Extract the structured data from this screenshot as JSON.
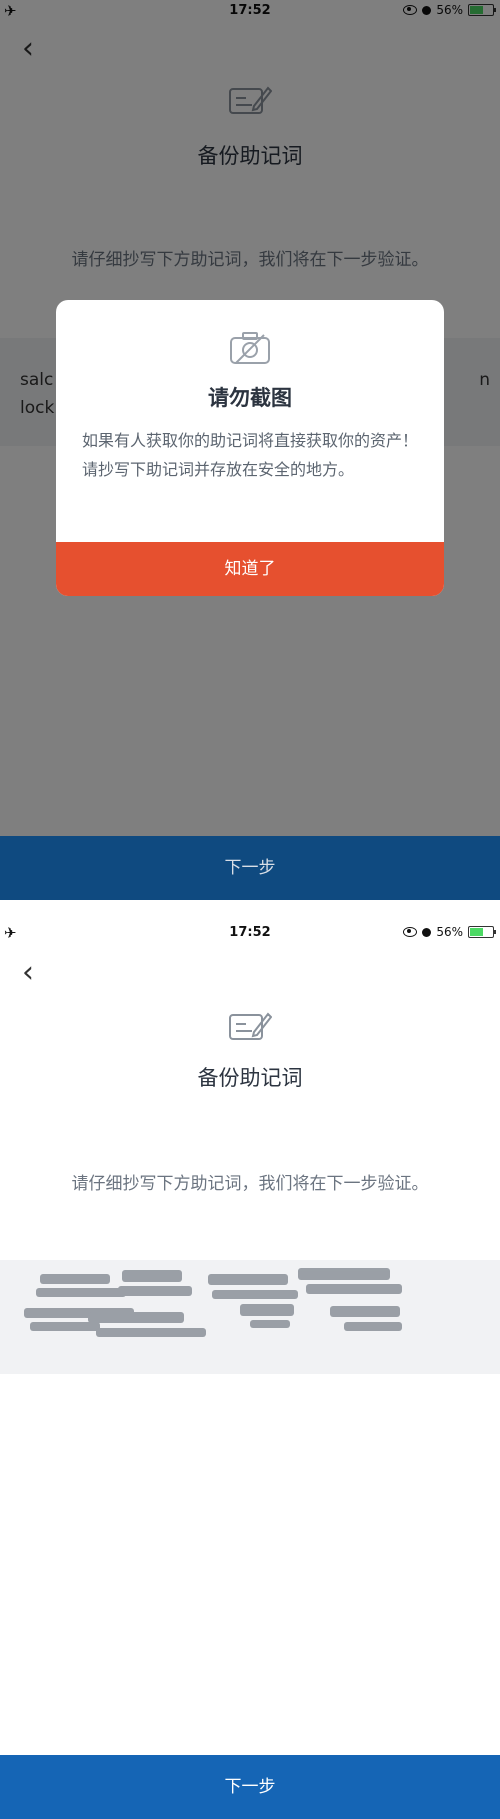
{
  "status_bar": {
    "time": "17:52",
    "battery": "56%",
    "battery_level": 0.56
  },
  "page": {
    "title": "备份助记词",
    "instruction": "请仔细抄写下方助记词，我们将在下一步验证。",
    "next_button": "下一步"
  },
  "mnemonic_visible": {
    "line1_left": "salc",
    "line1_right": "n",
    "line2_left": "lock"
  },
  "modal": {
    "title": "请勿截图",
    "body": "如果有人获取你的助记词将直接获取你的资产！请抄写下助记词并存放在安全的地方。",
    "confirm_button": "知道了"
  },
  "colors": {
    "accent_orange": "#e6502f",
    "primary_blue": "#1565b5",
    "dimmed_blue": "#0f4a80"
  },
  "icons": {
    "back": "chevron-left-icon",
    "document": "document-edit-icon",
    "camera_off": "camera-off-icon"
  }
}
